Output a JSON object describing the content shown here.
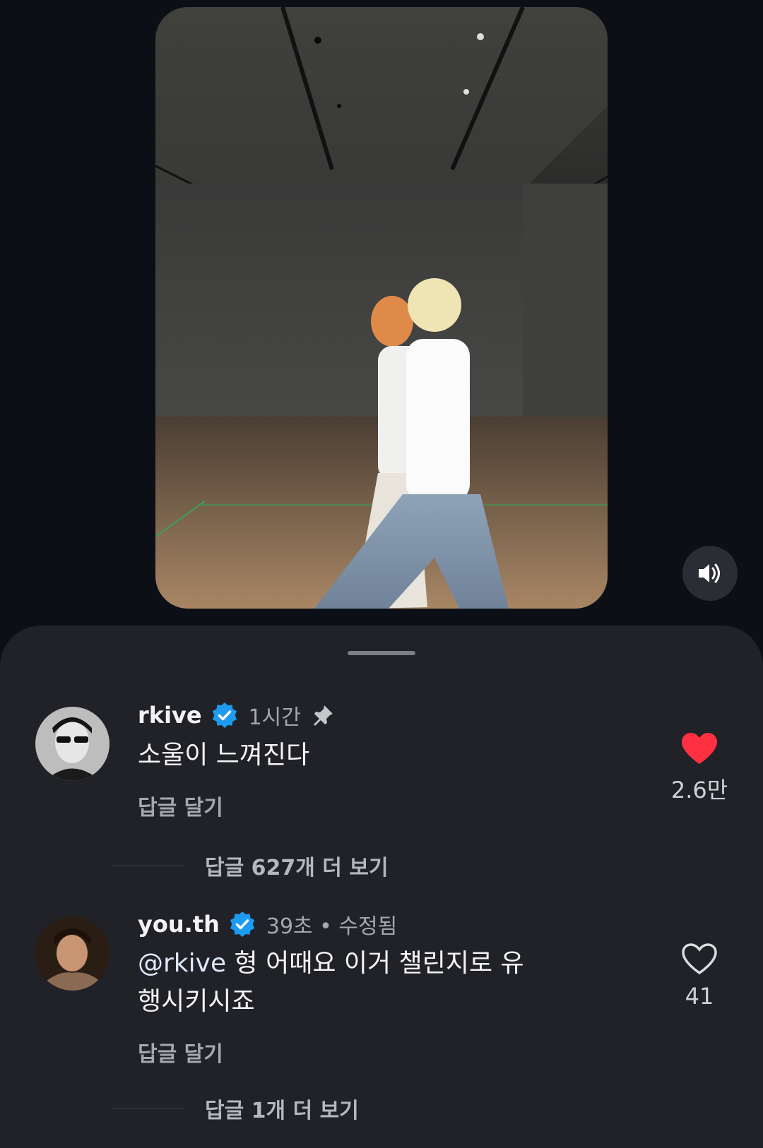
{
  "video": {
    "sound_icon": "speaker-icon"
  },
  "comments": [
    {
      "username": "rkive",
      "time": "1시간",
      "pinned": true,
      "text": "소울이 느껴진다",
      "reply_label": "답글 달기",
      "likes": "2.6만",
      "liked": true,
      "more_replies": "답글 627개 더 보기"
    },
    {
      "username": "you.th",
      "time": "39초 • 수정됨",
      "pinned": false,
      "mention": "@rkive",
      "text": " 형 어때요 이거 챌린지로 유행시키시죠",
      "reply_label": "답글 달기",
      "likes": "41",
      "liked": false,
      "more_replies": "답글 1개 더 보기"
    }
  ],
  "colors": {
    "like_red": "#ff3040",
    "verified_blue": "#1d9bf0",
    "sheet_bg": "#202227"
  }
}
